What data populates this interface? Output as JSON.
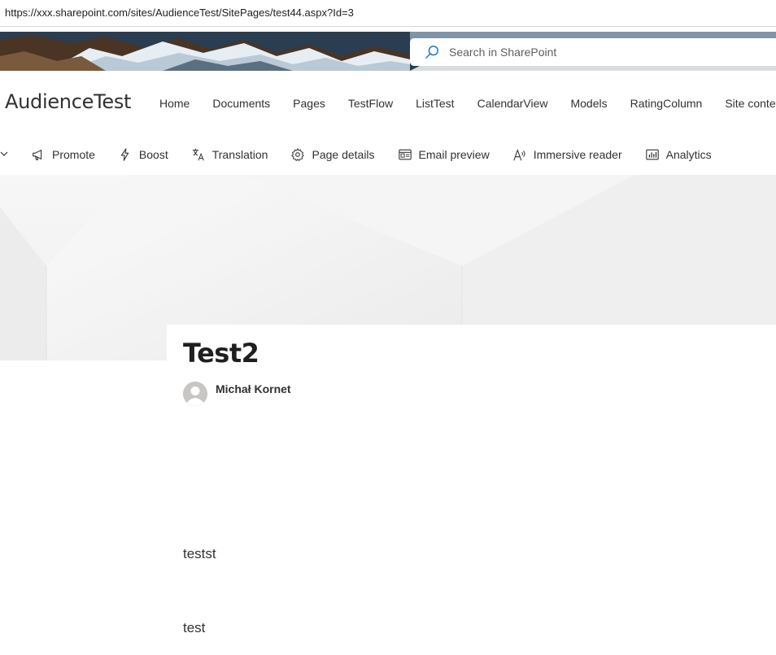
{
  "browser": {
    "url": "https://xxx.sharepoint.com/sites/AudienceTest/SitePages/test44.aspx?Id=3"
  },
  "suite_bar": {
    "search_placeholder": "Search in SharePoint"
  },
  "site": {
    "title": "AudienceTest",
    "nav": [
      {
        "label": "Home"
      },
      {
        "label": "Documents"
      },
      {
        "label": "Pages"
      },
      {
        "label": "TestFlow"
      },
      {
        "label": "ListTest"
      },
      {
        "label": "CalendarView"
      },
      {
        "label": "Models"
      },
      {
        "label": "RatingColumn"
      },
      {
        "label": "Site contents"
      }
    ]
  },
  "command_bar": {
    "items": [
      {
        "label": "Promote",
        "icon": "megaphone-icon"
      },
      {
        "label": "Boost",
        "icon": "lightning-icon"
      },
      {
        "label": "Translation",
        "icon": "translate-icon"
      },
      {
        "label": "Page details",
        "icon": "gear-icon"
      },
      {
        "label": "Email preview",
        "icon": "email-preview-icon"
      },
      {
        "label": "Immersive reader",
        "icon": "immersive-reader-icon"
      },
      {
        "label": "Analytics",
        "icon": "analytics-icon"
      }
    ]
  },
  "page": {
    "title": "Test2",
    "author": "Michał Kornet",
    "paragraphs": [
      "testst",
      "test"
    ]
  },
  "colors": {
    "accent": "#0f6cbd",
    "text": "#323130",
    "banner": "#f3f3f3"
  }
}
